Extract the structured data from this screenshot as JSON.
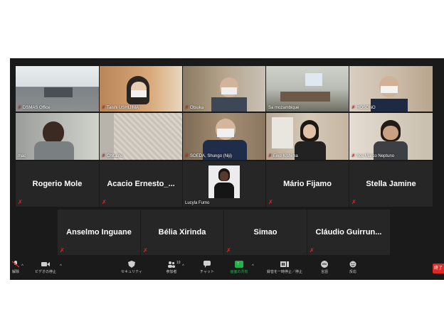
{
  "participants_video": [
    {
      "name": "DSMAS Office",
      "muted": true
    },
    {
      "name": "Taishi USHIJIMA",
      "muted": true
    },
    {
      "name": "Otsuka",
      "muted": true
    },
    {
      "name": "Sa mozambique",
      "muted": false
    },
    {
      "name": "HOSONO",
      "muted": true
    },
    {
      "name": "mac",
      "muted": false
    },
    {
      "name": "Chitaute",
      "muted": true
    },
    {
      "name": "SOEDA, Shungo (Niji)",
      "muted": true
    },
    {
      "name": "Eiko Kishima",
      "muted": true
    },
    {
      "name": "Ace Marco Neptuno",
      "muted": true
    }
  ],
  "participants_row3": [
    {
      "name": "Rogerio Mole"
    },
    {
      "name": "Acacio  Ernesto_..."
    },
    {
      "name": "Lucyla Fumo",
      "has_photo": true
    },
    {
      "name": "Mário Fijamo"
    },
    {
      "name": "Stella Jamine"
    }
  ],
  "participants_row4": [
    {
      "name": "Anselmo Inguane"
    },
    {
      "name": "Bélia Xirinda"
    },
    {
      "name": "Simao"
    },
    {
      "name": "Cláudio  Guirrun..."
    }
  ],
  "toolbar": {
    "mute_label": "解除",
    "video_label": "ビデオの停止",
    "security_label": "セキュリティ",
    "participants_label": "参加者",
    "participants_count": "19",
    "chat_label": "チャット",
    "share_label": "画面の共有",
    "record_label": "録音を一時停止／停止",
    "language_label": "言語",
    "language_code": "EN",
    "reactions_label": "反応",
    "end_label": "終了"
  },
  "colors": {
    "background": "#1a1a1a",
    "tile": "#262626",
    "active_speaker_border": "#c8d93a",
    "mute": "#e02828",
    "share_green": "#22b14c"
  }
}
